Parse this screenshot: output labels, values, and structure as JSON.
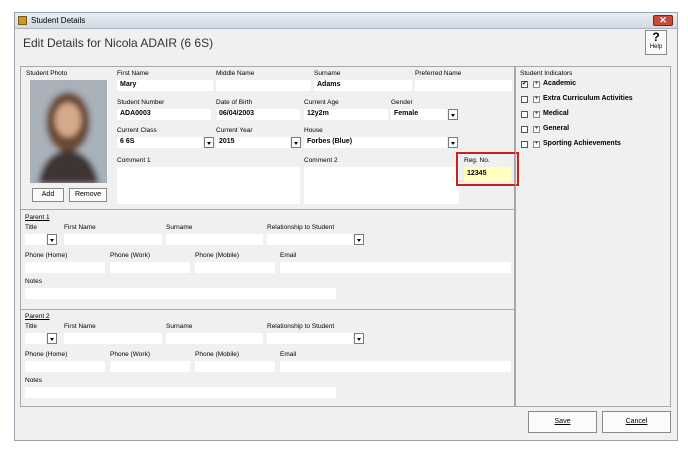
{
  "window": {
    "title": "Student Details",
    "close": "✕"
  },
  "header": {
    "title": "Edit Details for Nicola ADAIR (6 6S)",
    "help_icon": "?",
    "help_label": "Help"
  },
  "labels": {
    "student_photo": "Student Photo",
    "first_name": "First Name",
    "middle_name": "Middle Name",
    "surname": "Surname",
    "preferred_name": "Preferred Name",
    "student_number": "Student Number",
    "date_of_birth": "Date of Birth",
    "current_age": "Current Age",
    "gender": "Gender",
    "current_class": "Current Class",
    "current_year": "Current Year",
    "house": "House",
    "comment1": "Comment 1",
    "comment2": "Comment 2",
    "reg_no": "Reg. No."
  },
  "student": {
    "first_name": "Mary",
    "middle_name": "",
    "surname": "Adams",
    "preferred_name": "",
    "student_number": "ADA0003",
    "date_of_birth": "06/04/2003",
    "current_age": "12y2m",
    "gender": "Female",
    "current_class": "6 6S",
    "current_year": "2015",
    "house": "Forbes (Blue)",
    "comment1": "",
    "comment2": "",
    "reg_no": "12345"
  },
  "photo_buttons": {
    "add": "Add",
    "remove": "Remove"
  },
  "parent_labels": {
    "title": "Title",
    "first_name": "First Name",
    "surname": "Surname",
    "relationship": "Relationship to Student",
    "phone_home": "Phone (Home)",
    "phone_work": "Phone (Work)",
    "phone_mobile": "Phone (Mobile)",
    "email": "Email",
    "notes": "Notes"
  },
  "parents": [
    {
      "heading": "Parent 1"
    },
    {
      "heading": "Parent 2"
    }
  ],
  "indicators": {
    "title": "Student Indicators",
    "items": [
      {
        "label": "Academic",
        "checked": "✔"
      },
      {
        "label": "Extra Curriculum Activities",
        "checked": ""
      },
      {
        "label": "Medical",
        "checked": ""
      },
      {
        "label": "General",
        "checked": ""
      },
      {
        "label": "Sporting Achievements",
        "checked": ""
      }
    ]
  },
  "footer": {
    "save": "Save",
    "cancel": "Cancel"
  },
  "colors": {
    "reg_highlight": "#ffffc0",
    "reg_border": "#cc2020"
  }
}
